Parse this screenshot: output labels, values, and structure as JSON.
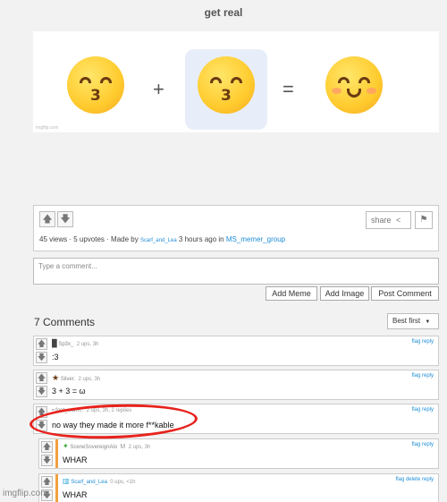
{
  "post": {
    "title": "get real",
    "watermark": "imgflip.com",
    "equation": {
      "plus": "+",
      "equals": "="
    },
    "stats": {
      "views": "45 views",
      "upvotes": "5 upvotes",
      "made_by_label": "Made by",
      "author": "Scarf_and_Lea",
      "time": "3 hours ago in",
      "group": "MS_memer_group"
    },
    "share_label": "share",
    "flag_icon": "flag-icon"
  },
  "comment_form": {
    "placeholder": "Type a comment...",
    "buttons": [
      "Add Meme",
      "Add Image",
      "Post Comment"
    ]
  },
  "comments_header": {
    "count": "7 Comments",
    "sort": "Best first"
  },
  "comments": [
    {
      "user": "Sp3x_",
      "meta": "2 ups, 3h",
      "text": ":3",
      "actions": "flag  reply"
    },
    {
      "user": "Silver.",
      "meta": "2 ups, 3h",
      "text": "3 + 3 = ω",
      "actions": "flag  reply"
    },
    {
      "user": "foot_wann..",
      "meta": "2 ups, 3h, 2 replies",
      "text": "no way they made it more f**kable",
      "actions": "flag  reply"
    },
    {
      "user": "SceneSovereignAlo",
      "badge": "M",
      "meta": "2 ups, 3h",
      "text": "WHAR",
      "actions": "flag  reply"
    },
    {
      "user": "Scarf_and_Lea",
      "meta": "0 ups, <1h",
      "text": "WHAR",
      "actions": "flag  delete  reply"
    }
  ],
  "site_watermark": "imgflip.com",
  "colors": {
    "link": "#1f8dd6",
    "annotation": "#e8211c",
    "reply_bar": "#f0a040",
    "highlight": "#e8eef9"
  }
}
